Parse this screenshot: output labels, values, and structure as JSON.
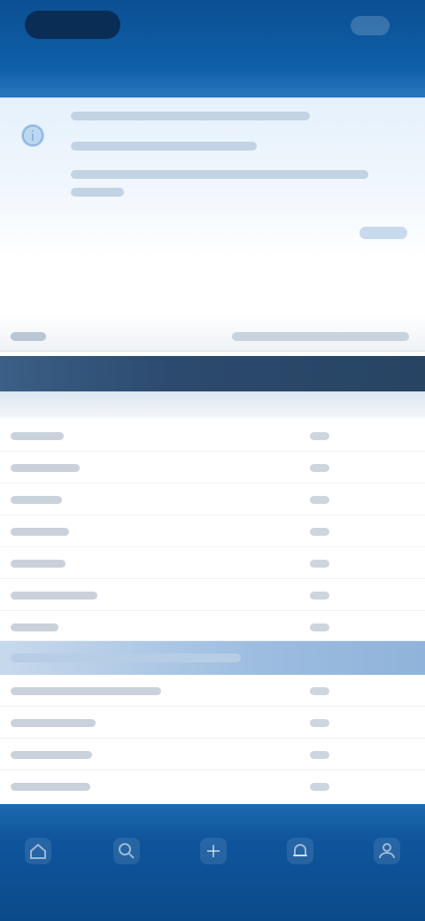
{
  "app": {
    "title": ""
  },
  "icons": {
    "info": "info-icon",
    "nav_home": "home-icon",
    "nav_search": "search-icon",
    "nav_add": "add-icon",
    "nav_alerts": "bell-icon",
    "nav_profile": "user-icon"
  },
  "colors": {
    "primary": "#0f5fa8",
    "section_dark": "#2c4a6e",
    "section_light": "#9dbde0",
    "banner_bg": "#e6f1fb"
  },
  "table": {
    "section_title": "",
    "rows": [
      {
        "name": "",
        "value": ""
      },
      {
        "name": "",
        "value": ""
      },
      {
        "name": "",
        "value": ""
      },
      {
        "name": "",
        "value": ""
      },
      {
        "name": "",
        "value": ""
      },
      {
        "name": "",
        "value": ""
      },
      {
        "name": "",
        "value": ""
      }
    ]
  },
  "section2": {
    "title": "",
    "rows": [
      {
        "name": "",
        "value": ""
      },
      {
        "name": "",
        "value": ""
      },
      {
        "name": "",
        "value": ""
      },
      {
        "name": "",
        "value": ""
      }
    ]
  },
  "bottom_nav": {
    "items": [
      {
        "label": ""
      },
      {
        "label": ""
      },
      {
        "label": ""
      },
      {
        "label": ""
      },
      {
        "label": ""
      }
    ]
  }
}
